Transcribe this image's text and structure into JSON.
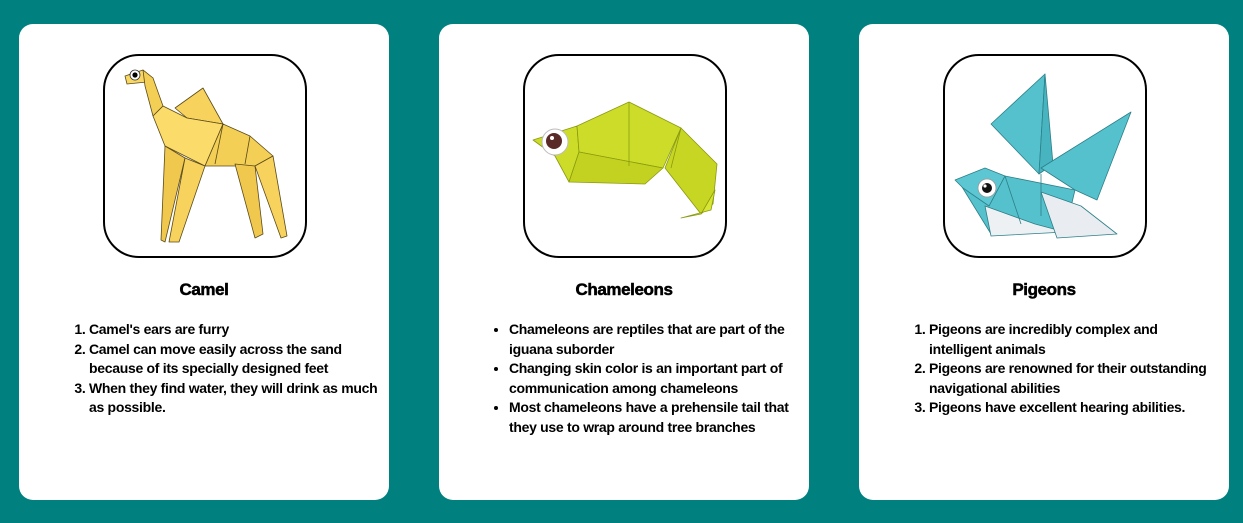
{
  "cards": [
    {
      "title": "Camel",
      "image_icon": "origami-camel",
      "list_style": "ordered",
      "facts": [
        "Camel's ears are furry",
        "Camel can move easily across the sand because of its specially designed feet",
        "When they find water, they will drink as much as possible."
      ]
    },
    {
      "title": "Chameleons",
      "image_icon": "origami-chameleon",
      "list_style": "bulleted",
      "facts": [
        "Chameleons are reptiles that are part of the iguana suborder",
        "Changing skin color is an important part of communication among chameleons",
        "Most chameleons have a prehensile tail that they use to wrap around tree branches"
      ]
    },
    {
      "title": "Pigeons",
      "image_icon": "origami-pigeon",
      "list_style": "ordered",
      "facts": [
        "Pigeons are incredibly complex and intelligent animals",
        "Pigeons are renowned for their outstanding navigational abilities",
        "Pigeons have excellent hearing abilities."
      ]
    }
  ],
  "colors": {
    "page_background": "#018080",
    "card_background": "#ffffff",
    "camel": "#f9d765",
    "chameleon": "#cddc29",
    "pigeon": "#55c1cc"
  }
}
